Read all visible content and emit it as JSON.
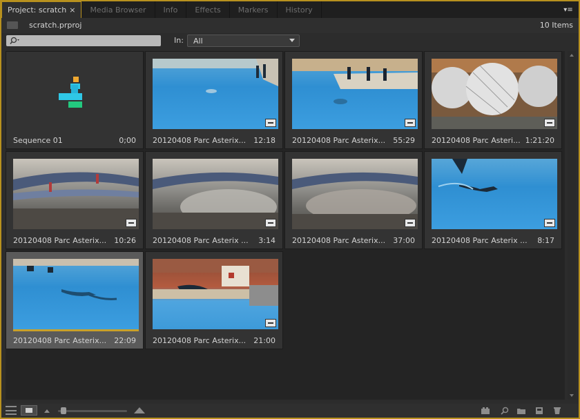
{
  "tabs": [
    {
      "label": "Project: scratch",
      "active": true
    },
    {
      "label": "Media Browser",
      "active": false
    },
    {
      "label": "Info",
      "active": false
    },
    {
      "label": "Effects",
      "active": false
    },
    {
      "label": "Markers",
      "active": false
    },
    {
      "label": "History",
      "active": false
    }
  ],
  "header": {
    "project_file": "scratch.prproj",
    "item_count": "10 Items"
  },
  "filter": {
    "in_label": "In:",
    "in_value": "All"
  },
  "items": [
    {
      "name": "Sequence 01",
      "duration": "0;00",
      "kind": "sequence"
    },
    {
      "name": "20120408 Parc Asterix...",
      "duration": "12:18",
      "kind": "pool"
    },
    {
      "name": "20120408 Parc Asterix...",
      "duration": "55:29",
      "kind": "pool"
    },
    {
      "name": "20120408 Parc Asteri...",
      "duration": "1:21:20",
      "kind": "balls"
    },
    {
      "name": "20120408 Parc Asterix...",
      "duration": "10:26",
      "kind": "dome"
    },
    {
      "name": "20120408 Parc Asterix ...",
      "duration": "3:14",
      "kind": "dome"
    },
    {
      "name": "20120408 Parc Asterix...",
      "duration": "37:00",
      "kind": "dome"
    },
    {
      "name": "20120408 Parc Asterix ...",
      "duration": "8:17",
      "kind": "pool"
    },
    {
      "name": "20120408 Parc Asterix...",
      "duration": "22:09",
      "kind": "pool",
      "selected": true
    },
    {
      "name": "20120408 Parc Asterix...",
      "duration": "21:00",
      "kind": "stadium"
    }
  ],
  "colors": {
    "active_border": "#b8911e",
    "panel_bg": "#2c2c2c"
  }
}
